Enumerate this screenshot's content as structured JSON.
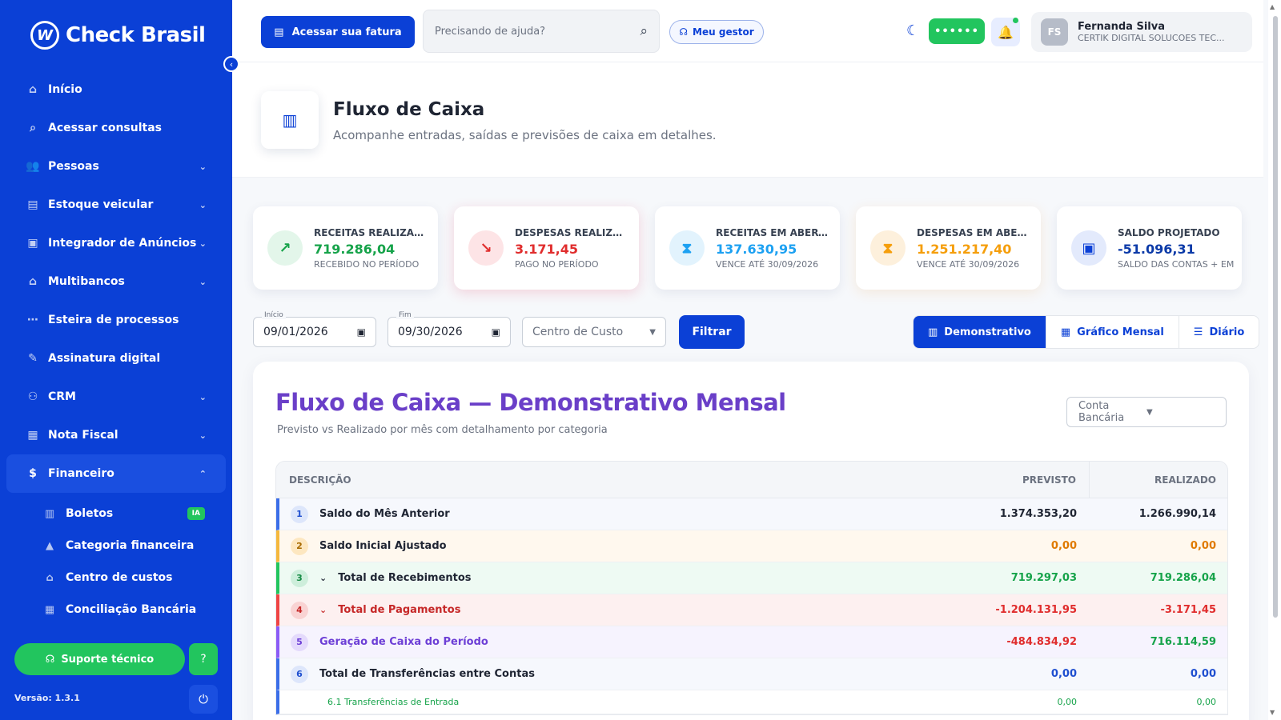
{
  "brand": {
    "name": "Check Brasil",
    "mark": "W"
  },
  "sidebar": {
    "items": [
      {
        "label": "Início",
        "icon": "home-icon",
        "glyph": "⌂"
      },
      {
        "label": "Acessar consultas",
        "icon": "search-icon",
        "glyph": "⌕"
      },
      {
        "label": "Pessoas",
        "icon": "users-icon",
        "glyph": "👥",
        "chevron": "⌄"
      },
      {
        "label": "Estoque veicular",
        "icon": "car-icon",
        "glyph": "▤",
        "chevron": "⌄"
      },
      {
        "label": "Integrador de Anúncios",
        "icon": "ads-icon",
        "glyph": "▣",
        "chevron": "⌄"
      },
      {
        "label": "Multibancos",
        "icon": "bank-icon",
        "glyph": "⌂",
        "chevron": "⌄"
      },
      {
        "label": "Esteira de processos",
        "icon": "flow-icon",
        "glyph": "⋯"
      },
      {
        "label": "Assinatura digital",
        "icon": "signature-icon",
        "glyph": "✎"
      },
      {
        "label": "CRM",
        "icon": "crm-icon",
        "glyph": "⚇",
        "chevron": "⌄"
      },
      {
        "label": "Nota Fiscal",
        "icon": "invoice-icon",
        "glyph": "▦",
        "chevron": "⌄"
      },
      {
        "label": "Financeiro",
        "icon": "finance-icon",
        "glyph": "$",
        "chevron": "⌃"
      }
    ],
    "sub_items": [
      {
        "label": "Boletos",
        "icon": "boleto-icon",
        "glyph": "▥",
        "badge": "IA"
      },
      {
        "label": "Categoria financeira",
        "icon": "category-icon",
        "glyph": "▲"
      },
      {
        "label": "Centro de custos",
        "icon": "bank-icon",
        "glyph": "⌂"
      },
      {
        "label": "Conciliação Bancária",
        "icon": "reconcile-icon",
        "glyph": "▦"
      }
    ],
    "support_label": "Suporte técnico",
    "version": "Versão: 1.3.1"
  },
  "topbar": {
    "fatura_label": "Acessar sua fatura",
    "search_placeholder": "Precisando de ajuda?",
    "gestor_label": "Meu gestor",
    "status_pill": "••••••",
    "user": {
      "initials": "FS",
      "name": "Fernanda Silva",
      "company": "CERTIK DIGITAL SOLUCOES TEC..."
    }
  },
  "page": {
    "title": "Fluxo de Caixa",
    "subtitle": "Acompanhe entradas, saídas e previsões de caixa em detalhes."
  },
  "cards": [
    {
      "label": "RECEITAS REALIZAD...",
      "value": "719.286,04",
      "note": "RECEBIDO NO PERÍODO",
      "icon": "trend-up-icon",
      "glyph": "↗",
      "color": "#16a34a",
      "bg": "#e3f6ea"
    },
    {
      "label": "DESPESAS REALIZA...",
      "value": "3.171,45",
      "note": "PAGO NO PERÍODO",
      "icon": "trend-down-icon",
      "glyph": "↘",
      "color": "#e02d2d",
      "bg": "#fde4e6"
    },
    {
      "label": "RECEITAS EM ABERT...",
      "value": "137.630,95",
      "note": "VENCE ATÉ 30/09/2026",
      "icon": "hourglass-icon",
      "glyph": "⧗",
      "color": "#1da1f2",
      "bg": "#e2f3fd"
    },
    {
      "label": "DESPESAS EM ABER...",
      "value": "1.251.217,40",
      "note": "VENCE ATÉ 30/09/2026",
      "icon": "hourglass-icon",
      "glyph": "⧗",
      "color": "#f59e0b",
      "bg": "#fdf0dc"
    },
    {
      "label": "SALDO PROJETADO",
      "value": "-51.096,31",
      "note": "SALDO DAS CONTAS + EM",
      "icon": "wallet-icon",
      "glyph": "▣",
      "color": "#0b40d6",
      "bg": "#e3eafc"
    }
  ],
  "filters": {
    "inicio_label": "Início",
    "inicio_value": "09/01/2026",
    "fim_label": "Fim",
    "fim_value": "09/30/2026",
    "centro_placeholder": "Centro de Custo",
    "filtrar_label": "Filtrar"
  },
  "views": [
    {
      "label": "Demonstrativo",
      "glyph": "▥",
      "active": true
    },
    {
      "label": "Gráfico Mensal",
      "glyph": "▦",
      "active": false
    },
    {
      "label": "Diário",
      "glyph": "☰",
      "active": false
    }
  ],
  "panel": {
    "title": "Fluxo de Caixa — Demonstrativo Mensal",
    "subtitle": "Previsto vs Realizado por mês com detalhamento por categoria",
    "conta_placeholder": "Conta Bancária",
    "columns": {
      "desc": "DESCRIÇÃO",
      "previsto": "PREVISTO",
      "realizado": "REALIZADO"
    },
    "rows": [
      {
        "n": "1",
        "desc": "Saldo do Mês Anterior",
        "previsto": "1.374.353,20",
        "realizado": "1.266.990,14"
      },
      {
        "n": "2",
        "desc": "Saldo Inicial Ajustado",
        "previsto": "0,00",
        "realizado": "0,00"
      },
      {
        "n": "3",
        "desc": "Total de Recebimentos",
        "previsto": "719.297,03",
        "realizado": "719.286,04",
        "caret": "⌄"
      },
      {
        "n": "4",
        "desc": "Total de Pagamentos",
        "previsto": "-1.204.131,95",
        "realizado": "-3.171,45",
        "caret": "⌄"
      },
      {
        "n": "5",
        "desc": "Geração de Caixa do Período",
        "previsto": "-484.834,92",
        "realizado": "716.114,59"
      },
      {
        "n": "6",
        "desc": "Total de Transferências entre Contas",
        "previsto": "0,00",
        "realizado": "0,00"
      }
    ],
    "sub_row": {
      "desc": "6.1 Transferências de Entrada",
      "previsto": "0,00",
      "realizado": "0,00"
    }
  }
}
